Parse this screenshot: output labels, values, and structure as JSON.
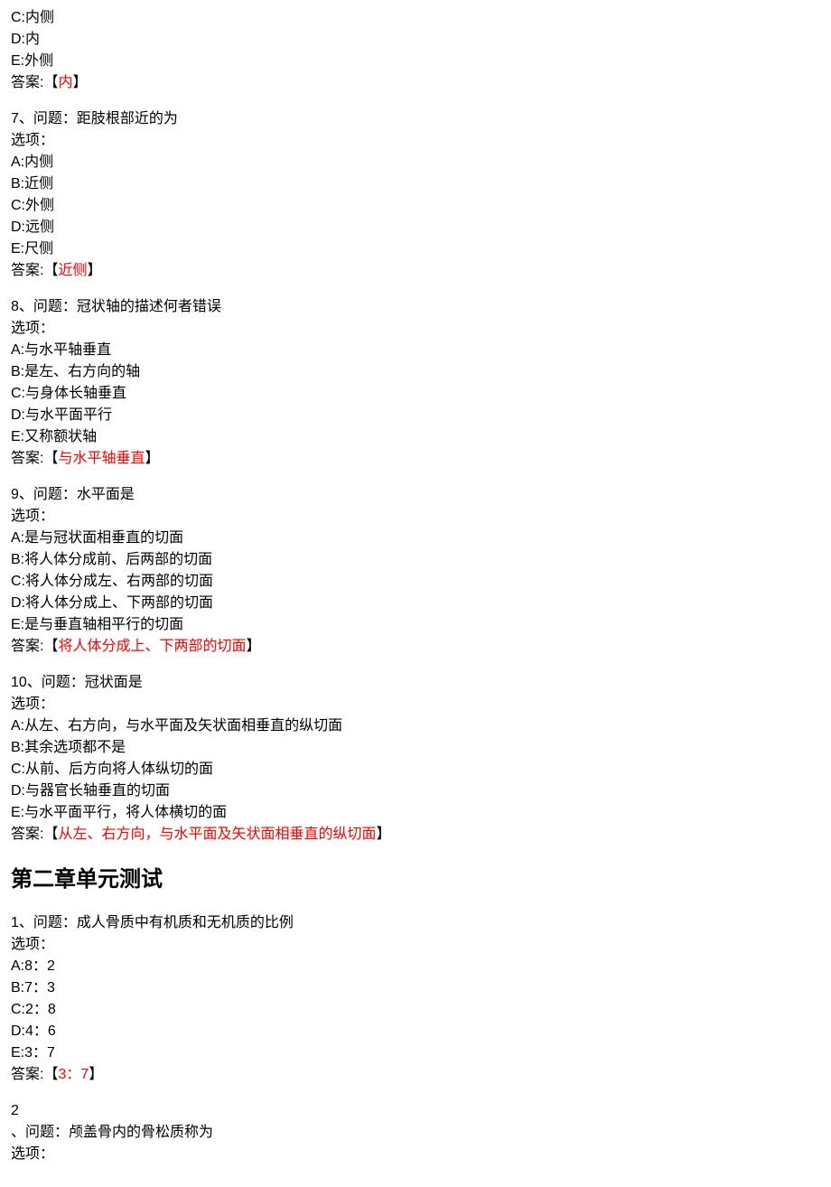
{
  "partial_q6": {
    "options": [
      "C:内侧",
      "D:内",
      "E:外侧"
    ],
    "answer_prefix": "答案:【",
    "answer": "内",
    "answer_suffix": "】"
  },
  "q7": {
    "header": "7、问题：距肢根部近的为",
    "options_label": "选项：",
    "options": [
      "A:内侧",
      "B:近侧",
      "C:外侧",
      "D:远侧",
      "E:尺侧"
    ],
    "answer_prefix": "答案:【",
    "answer": "近侧",
    "answer_suffix": "】"
  },
  "q8": {
    "header": "8、问题：冠状轴的描述何者错误",
    "options_label": "选项：",
    "options": [
      "A:与水平轴垂直",
      "B:是左、右方向的轴",
      "C:与身体长轴垂直",
      "D:与水平面平行",
      "E:又称额状轴"
    ],
    "answer_prefix": "答案:【",
    "answer": "与水平轴垂直",
    "answer_suffix": "】"
  },
  "q9": {
    "header": "9、问题：水平面是",
    "options_label": "选项：",
    "options": [
      "A:是与冠状面相垂直的切面",
      "B:将人体分成前、后两部的切面",
      "C:将人体分成左、右两部的切面",
      "D:将人体分成上、下两部的切面",
      "E:是与垂直轴相平行的切面"
    ],
    "answer_prefix": "答案:【",
    "answer": "将人体分成上、下两部的切面",
    "answer_suffix": "】"
  },
  "q10": {
    "header": "10、问题：冠状面是",
    "options_label": "选项：",
    "options": [
      "A:从左、右方向，与水平面及矢状面相垂直的纵切面",
      "B:其余选项都不是",
      "C:从前、后方向将人体纵切的面",
      "D:与器官长轴垂直的切面",
      "E:与水平面平行，将人体横切的面"
    ],
    "answer_prefix": "答案:【",
    "answer": "从左、右方向，与水平面及矢状面相垂直的纵切面",
    "answer_suffix": "】"
  },
  "chapter2_title": "第二章单元测试",
  "c2_q1": {
    "header": "1、问题：成人骨质中有机质和无机质的比例",
    "options_label": "选项：",
    "options": [
      "A:8：2",
      "B:7：3",
      "C:2：8",
      "D:4：6",
      "E:3：7"
    ],
    "answer_prefix": "答案:【",
    "answer": "3：7",
    "answer_suffix": "】"
  },
  "c2_q2": {
    "number": "2",
    "header": "、问题：颅盖骨内的骨松质称为",
    "options_label": "选项："
  }
}
